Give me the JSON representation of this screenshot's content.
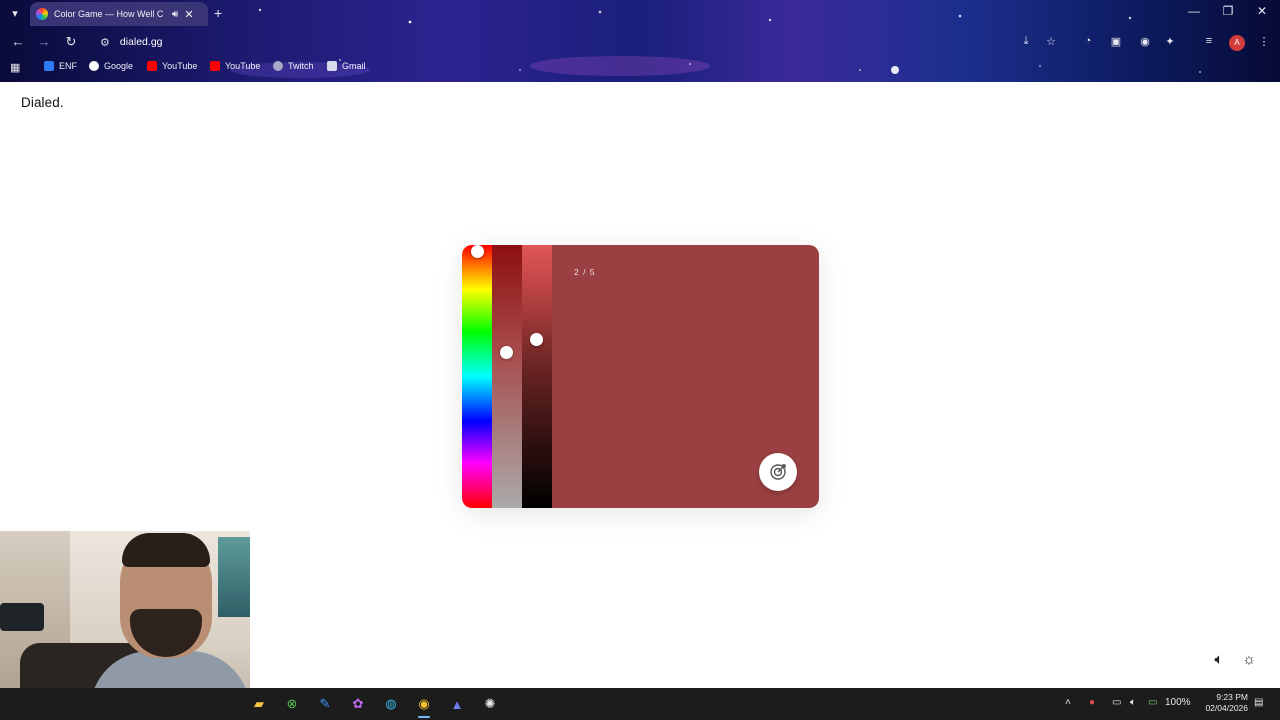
{
  "browser": {
    "tab": {
      "title": "Color Game — How Well C",
      "audio_icon": "speaker-icon",
      "close_icon": "close-icon"
    },
    "new_tab_icon": "plus-icon",
    "window_controls": [
      "—",
      "❐",
      "✕"
    ],
    "nav": {
      "back": "←",
      "forward": "→",
      "reload": "↻"
    },
    "url": "dialed.gg",
    "bookmarks": [
      {
        "label": "ENF",
        "color": "#2f7bf5"
      },
      {
        "label": "Google",
        "color": "#ffffff"
      },
      {
        "label": "YouTube",
        "color": "#ff0000"
      },
      {
        "label": "YouTube",
        "color": "#ff0000"
      },
      {
        "label": "Twitch",
        "color": "#a9a9c8"
      },
      {
        "label": "Gmail",
        "color": "#d9d9ec"
      }
    ],
    "profile_initial": "A"
  },
  "page": {
    "brand": "Dialed.",
    "game": {
      "progress": "2 / 5",
      "target_color": "#9b4042",
      "hue_handle_level": 0.0,
      "saturation_handle_level": 0.41,
      "lightness_handle_level": 0.36,
      "submit_icon": "target-icon"
    },
    "controls": {
      "sound_icon": "speaker-icon",
      "theme_icon": "sun-icon"
    }
  },
  "taskbar": {
    "apps": [
      "file-explorer-icon",
      "xbox-icon",
      "whiteboard-icon",
      "copilot-icon",
      "edge-icon",
      "chrome-icon",
      "app-icon",
      "chatgpt-icon"
    ],
    "tray": {
      "battery": "100%"
    },
    "time": "9:23 PM",
    "date": "02/04/2026"
  }
}
